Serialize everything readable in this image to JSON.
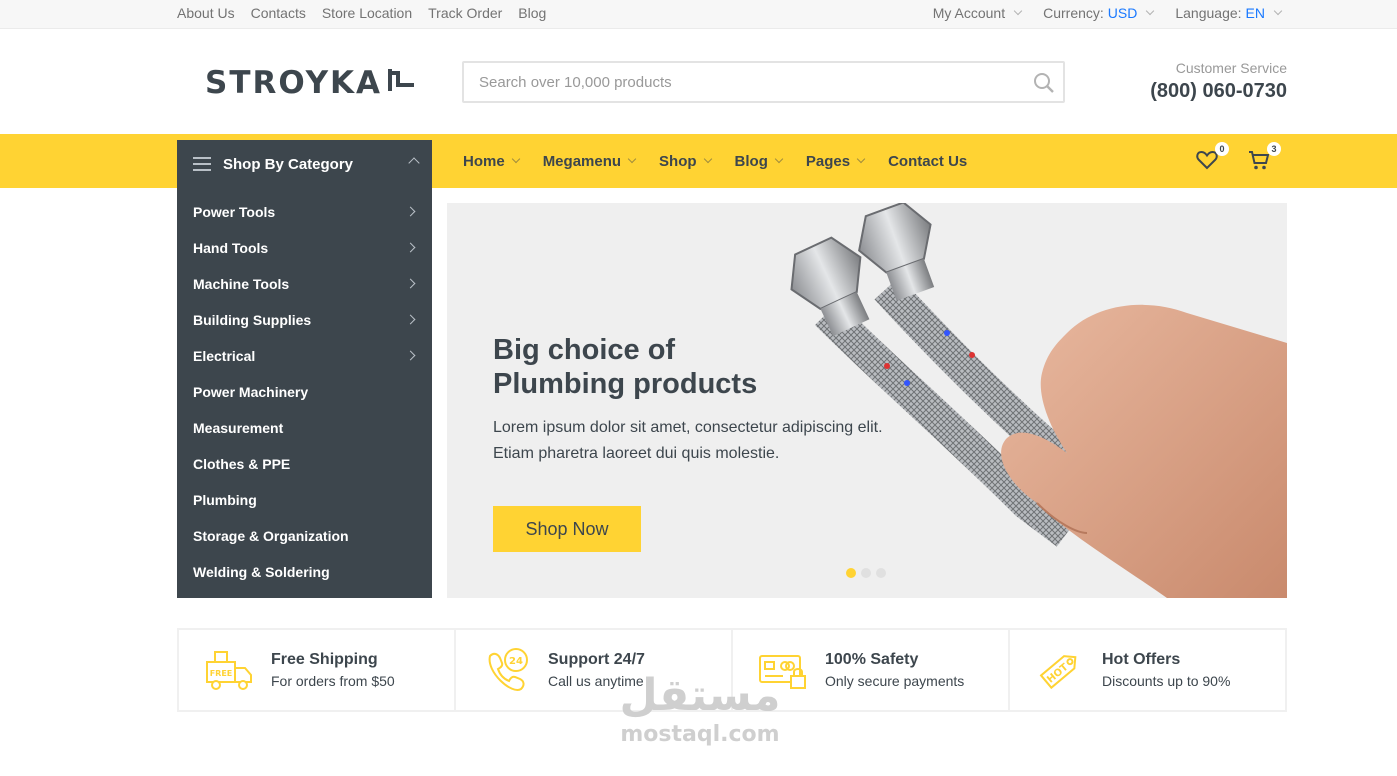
{
  "topbar": {
    "links": [
      "About Us",
      "Contacts",
      "Store Location",
      "Track Order",
      "Blog"
    ],
    "my_account": "My Account",
    "currency_label": "Currency:",
    "currency_value": "USD",
    "language_label": "Language:",
    "language_value": "EN"
  },
  "header": {
    "logo_text": "STROYKA",
    "search_placeholder": "Search over 10,000 products",
    "service_label": "Customer Service",
    "service_phone": "(800) 060-0730"
  },
  "nav": {
    "category_title": "Shop By Category",
    "links": [
      "Home",
      "Megamenu",
      "Shop",
      "Blog",
      "Pages",
      "Contact Us"
    ],
    "wishlist_count": "0",
    "cart_count": "3"
  },
  "categories": [
    {
      "label": "Power Tools",
      "has_sub": true
    },
    {
      "label": "Hand Tools",
      "has_sub": true
    },
    {
      "label": "Machine Tools",
      "has_sub": true
    },
    {
      "label": "Building Supplies",
      "has_sub": true
    },
    {
      "label": "Electrical",
      "has_sub": true
    },
    {
      "label": "Power Machinery",
      "has_sub": false
    },
    {
      "label": "Measurement",
      "has_sub": false
    },
    {
      "label": "Clothes & PPE",
      "has_sub": false
    },
    {
      "label": "Plumbing",
      "has_sub": false
    },
    {
      "label": "Storage & Organization",
      "has_sub": false
    },
    {
      "label": "Welding & Soldering",
      "has_sub": false
    }
  ],
  "hero": {
    "title_line1": "Big choice of",
    "title_line2": "Plumbing products",
    "text_line1": "Lorem ipsum dolor sit amet, consectetur adipiscing elit.",
    "text_line2": "Etiam pharetra laoreet dui quis molestie.",
    "button": "Shop Now",
    "slide_count": 3,
    "active_slide": 1
  },
  "features": [
    {
      "title": "Free Shipping",
      "subtitle": "For orders from $50",
      "icon": "free-shipping-truck-icon",
      "icon_text": "FREE"
    },
    {
      "title": "Support 24/7",
      "subtitle": "Call us anytime",
      "icon": "support-phone-icon",
      "icon_text": "24"
    },
    {
      "title": "100% Safety",
      "subtitle": "Only secure payments",
      "icon": "secure-payment-icon"
    },
    {
      "title": "Hot Offers",
      "subtitle": "Discounts up to 90%",
      "icon": "hot-tag-icon",
      "icon_text": "HOT"
    }
  ],
  "watermark": {
    "arabic": "مستقل",
    "latin": "mostaql.com"
  },
  "colors": {
    "accent": "#ffd333",
    "dark": "#3d464d",
    "link_blue": "#1a79ff"
  }
}
